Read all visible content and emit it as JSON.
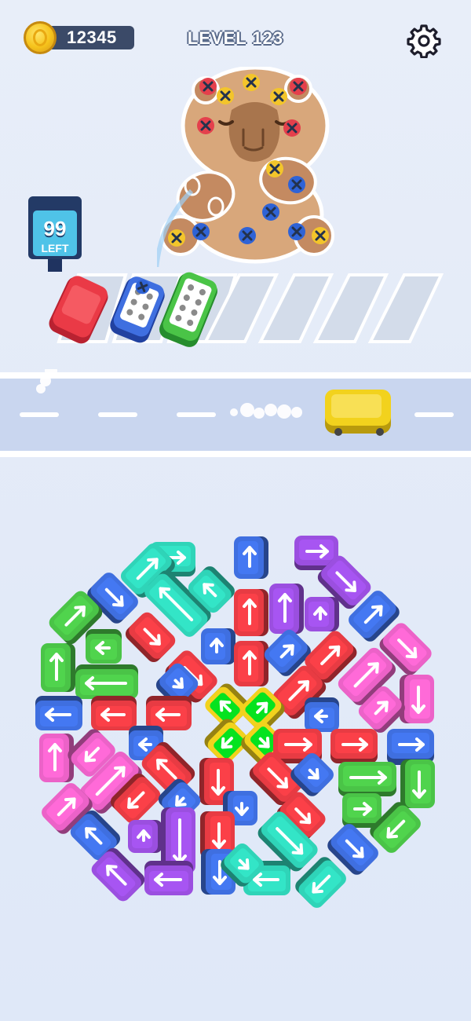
{
  "hud": {
    "coins": "12345",
    "level_label": "LEVEL 123",
    "coin_icon": "coin-icon",
    "settings_icon": "gear-icon"
  },
  "queue": {
    "count": "99",
    "label": "LEFT"
  },
  "colors": {
    "red": "#e83b43",
    "blue": "#3f6fe0",
    "green": "#4ac447",
    "teal": "#2fd4b8",
    "purple": "#9b4fe0",
    "pink": "#ec62c8",
    "yellow": "#f2d21d"
  },
  "slots": [
    {
      "state": "filled",
      "color": "red"
    },
    {
      "state": "filled",
      "color": "blue"
    },
    {
      "state": "filled",
      "color": "green"
    },
    {
      "state": "empty"
    },
    {
      "state": "empty"
    },
    {
      "state": "empty"
    },
    {
      "state": "empty"
    }
  ],
  "board_cars": [
    {
      "color": "teal",
      "dir": "right"
    },
    {
      "color": "blue",
      "dir": "up"
    },
    {
      "color": "purple",
      "dir": "right"
    },
    {
      "color": "teal",
      "dir": "up-right"
    },
    {
      "color": "purple",
      "dir": "down-right"
    },
    {
      "color": "blue",
      "dir": "down-right"
    },
    {
      "color": "teal",
      "dir": "up-left"
    },
    {
      "color": "teal",
      "dir": "up-left"
    },
    {
      "color": "red",
      "dir": "up"
    },
    {
      "color": "purple",
      "dir": "up"
    },
    {
      "color": "purple",
      "dir": "up"
    },
    {
      "color": "blue",
      "dir": "up-right"
    },
    {
      "color": "green",
      "dir": "up-right"
    },
    {
      "color": "red",
      "dir": "down-right"
    },
    {
      "color": "blue",
      "dir": "up"
    },
    {
      "color": "red",
      "dir": "up"
    },
    {
      "color": "blue",
      "dir": "up-right"
    },
    {
      "color": "red",
      "dir": "up-right"
    },
    {
      "color": "pink",
      "dir": "down-right"
    },
    {
      "color": "green",
      "dir": "left"
    },
    {
      "color": "green",
      "dir": "up"
    },
    {
      "color": "green",
      "dir": "left"
    },
    {
      "color": "red",
      "dir": "down-right"
    },
    {
      "color": "blue",
      "dir": "down-right"
    },
    {
      "color": "red",
      "dir": "up-right"
    },
    {
      "color": "pink",
      "dir": "up-right"
    },
    {
      "color": "pink",
      "dir": "down"
    },
    {
      "color": "blue",
      "dir": "left"
    },
    {
      "color": "red",
      "dir": "left"
    },
    {
      "color": "red",
      "dir": "left"
    },
    {
      "color": "yellow",
      "dir": "up-left"
    },
    {
      "color": "yellow",
      "dir": "up-right"
    },
    {
      "color": "blue",
      "dir": "left"
    },
    {
      "color": "pink",
      "dir": "up-right"
    },
    {
      "color": "blue",
      "dir": "right"
    },
    {
      "color": "pink",
      "dir": "up"
    },
    {
      "color": "pink",
      "dir": "down-left"
    },
    {
      "color": "blue",
      "dir": "left"
    },
    {
      "color": "yellow",
      "dir": "down-left"
    },
    {
      "color": "yellow",
      "dir": "down-right"
    },
    {
      "color": "red",
      "dir": "right"
    },
    {
      "color": "red",
      "dir": "right"
    },
    {
      "color": "blue",
      "dir": "right"
    },
    {
      "color": "pink",
      "dir": "up-right"
    },
    {
      "color": "red",
      "dir": "up-left"
    },
    {
      "color": "red",
      "dir": "down"
    },
    {
      "color": "red",
      "dir": "down-right"
    },
    {
      "color": "blue",
      "dir": "down-right"
    },
    {
      "color": "green",
      "dir": "right"
    },
    {
      "color": "green",
      "dir": "down"
    },
    {
      "color": "pink",
      "dir": "up-right"
    },
    {
      "color": "red",
      "dir": "down-left"
    },
    {
      "color": "blue",
      "dir": "down-left"
    },
    {
      "color": "blue",
      "dir": "down"
    },
    {
      "color": "red",
      "dir": "down-right"
    },
    {
      "color": "green",
      "dir": "right"
    },
    {
      "color": "blue",
      "dir": "up-left"
    },
    {
      "color": "purple",
      "dir": "up"
    },
    {
      "color": "purple",
      "dir": "down"
    },
    {
      "color": "red",
      "dir": "down"
    },
    {
      "color": "teal",
      "dir": "down-right"
    },
    {
      "color": "blue",
      "dir": "down-right"
    },
    {
      "color": "green",
      "dir": "down-left"
    },
    {
      "color": "purple",
      "dir": "up-left"
    },
    {
      "color": "purple",
      "dir": "left"
    },
    {
      "color": "blue",
      "dir": "down"
    },
    {
      "color": "teal",
      "dir": "left"
    },
    {
      "color": "teal",
      "dir": "down-right"
    },
    {
      "color": "teal",
      "dir": "down-left"
    }
  ]
}
